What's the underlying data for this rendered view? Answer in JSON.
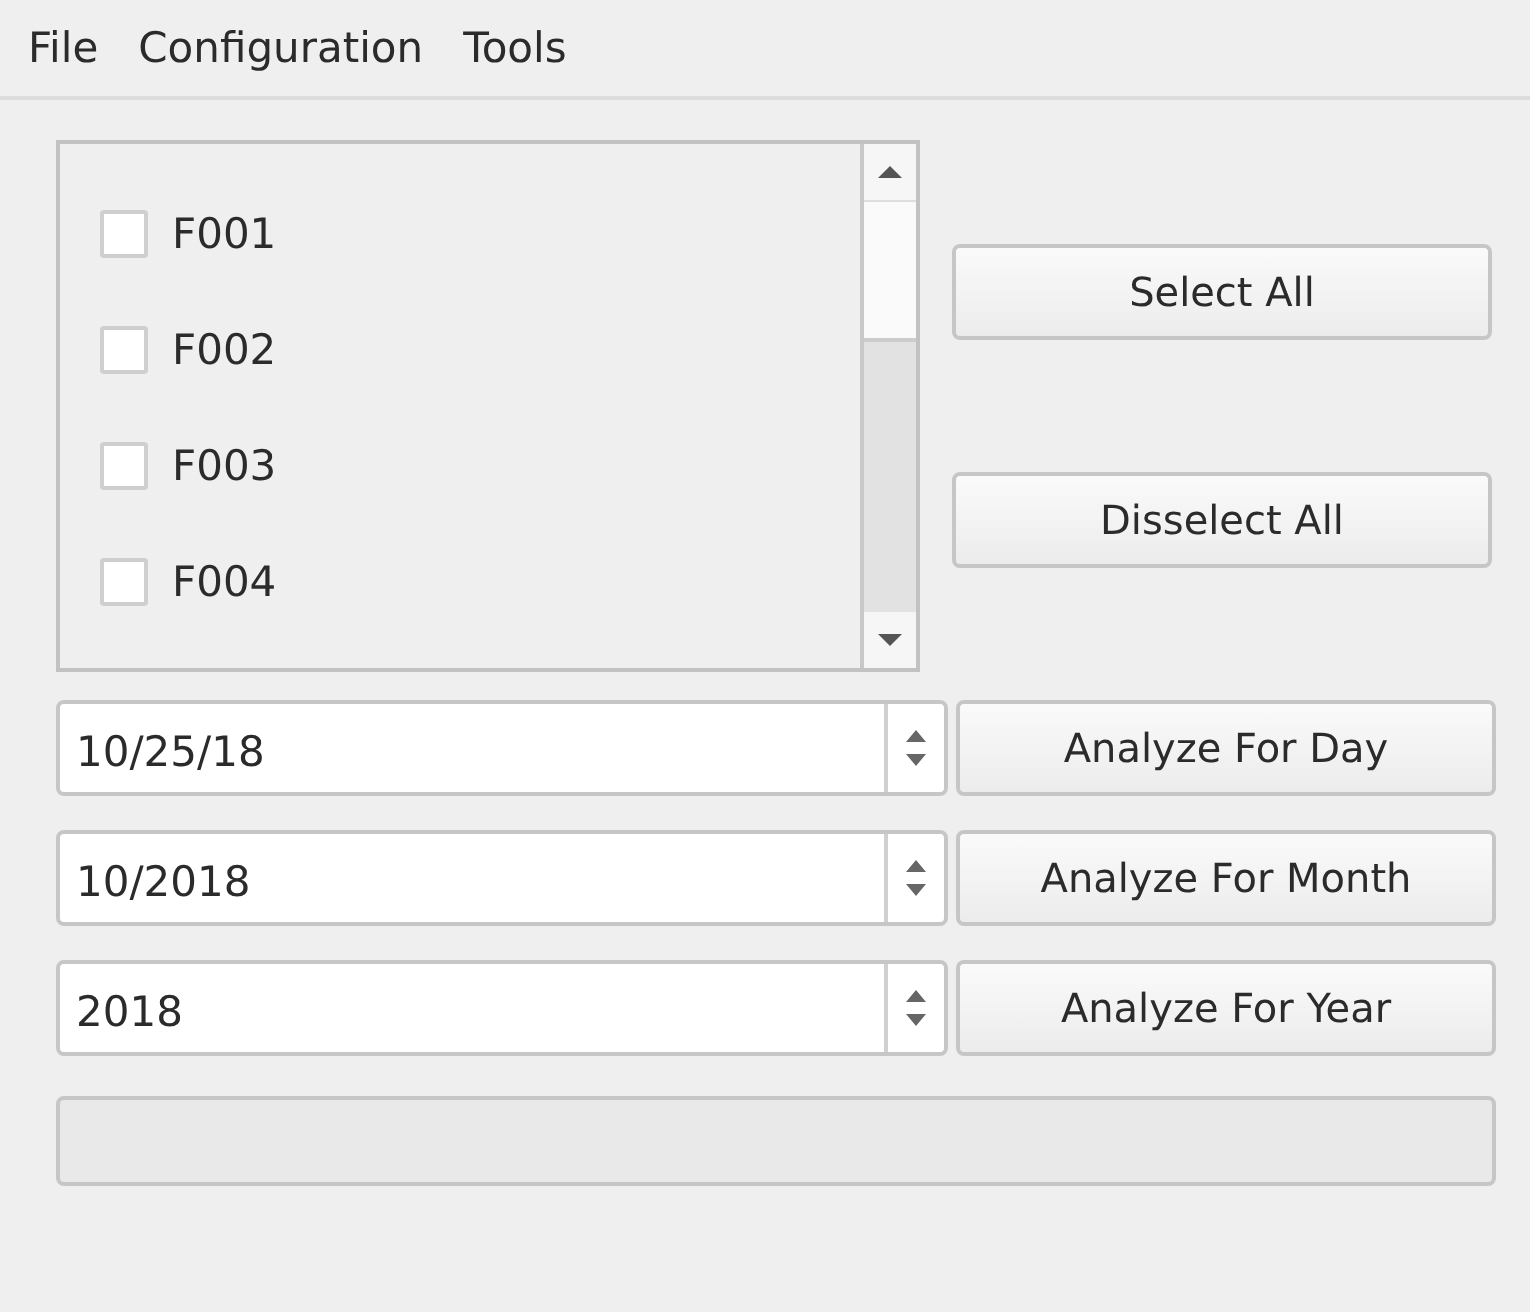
{
  "menu": [
    "File",
    "Configuration",
    "Tools"
  ],
  "list": {
    "items": [
      {
        "label": "F001",
        "checked": false
      },
      {
        "label": "F002",
        "checked": false
      },
      {
        "label": "F003",
        "checked": false
      },
      {
        "label": "F004",
        "checked": false
      }
    ],
    "scroll_buttons": [
      "Select All",
      "Disselect All"
    ]
  },
  "analysis_rows": [
    {
      "value": "10/25/18",
      "button": "Analyze For Day"
    },
    {
      "value": "10/2018",
      "button": "Analyze For Month"
    },
    {
      "value": "2018",
      "button": "Analyze For Year"
    }
  ],
  "progress_bar": {
    "level": 0
  }
}
